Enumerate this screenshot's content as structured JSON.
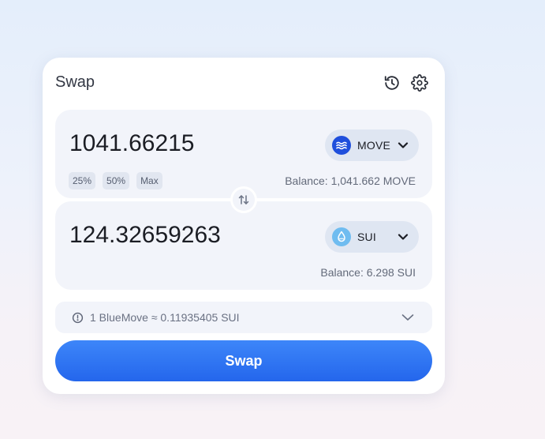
{
  "header": {
    "title": "Swap",
    "history_icon": "history-icon",
    "settings_icon": "gear-icon"
  },
  "from": {
    "amount": "1041.66215",
    "token": {
      "symbol": "MOVE",
      "logo_icon": "move-token-icon",
      "logo_color": "#1f4fdc"
    },
    "percent_buttons": [
      "25%",
      "50%",
      "Max"
    ],
    "balance": "Balance: 1,041.662 MOVE"
  },
  "to": {
    "amount": "124.32659263",
    "token": {
      "symbol": "SUI",
      "logo_icon": "sui-token-icon",
      "logo_color": "#6fbcf0"
    },
    "balance": "Balance: 6.298 SUI"
  },
  "flip_icon": "swap-direction-icon",
  "rate": {
    "text": "1 BlueMove ≈ 0.11935405 SUI",
    "info_icon": "info-icon",
    "expand_icon": "chevron-down-icon"
  },
  "swap_button": {
    "label": "Swap",
    "color": "#2b6ef2"
  }
}
